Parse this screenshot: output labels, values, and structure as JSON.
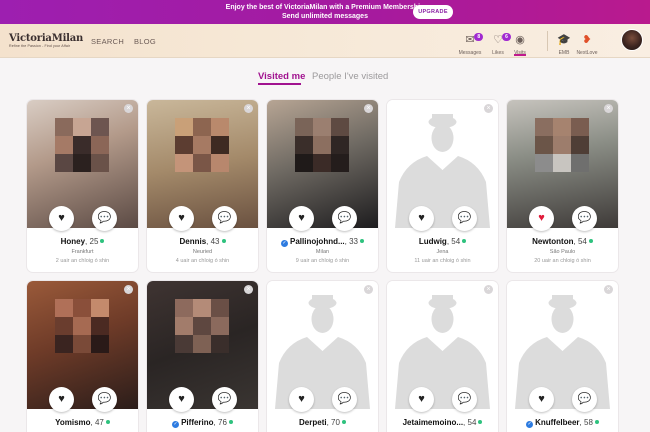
{
  "promo": {
    "line1": "Enjoy the best of VictoriaMilan with a Premium Membership",
    "line2": "Send unlimited messages",
    "button": "UPGRADE"
  },
  "nav": {
    "logo": "VictoriaMilan",
    "tagline": "Refine the Passion - Find your Affair",
    "links": [
      "SEARCH",
      "BLOG"
    ],
    "icons": [
      {
        "name": "messages-icon",
        "label": "Messages",
        "badge": "8"
      },
      {
        "name": "likes-icon",
        "label": "Likes",
        "badge": "6"
      },
      {
        "name": "visits-icon",
        "label": "Visits",
        "badge": ""
      },
      {
        "name": "emb-icon",
        "label": "EMB",
        "badge": ""
      },
      {
        "name": "nextlove-icon",
        "label": "NextLove",
        "badge": ""
      }
    ]
  },
  "tabs": {
    "active": "Visited me",
    "inactive": "People I've visited"
  },
  "accent_color": "#a1128f",
  "profiles": [
    {
      "name": "Honey",
      "age": "25",
      "city": "Frankfurt",
      "ago": "2 uair an chloig ó shin",
      "verified": false,
      "online": true,
      "liked": false
    },
    {
      "name": "Dennis",
      "age": "43",
      "city": "Neuried",
      "ago": "4 uair an chloig ó shin",
      "verified": false,
      "online": true,
      "liked": false
    },
    {
      "name": "Pallinojohnd...",
      "age": "33",
      "city": "Milan",
      "ago": "9 uair an chloig ó shin",
      "verified": true,
      "online": true,
      "liked": false
    },
    {
      "name": "Ludwig",
      "age": "54",
      "city": "Jena",
      "ago": "11 uair an chloig ó shin",
      "verified": false,
      "online": true,
      "liked": false
    },
    {
      "name": "Newtonton",
      "age": "54",
      "city": "São Paulo",
      "ago": "20 uair an chloig ó shin",
      "verified": false,
      "online": true,
      "liked": true
    },
    {
      "name": "Yomismo",
      "age": "47",
      "city": "",
      "ago": "",
      "verified": false,
      "online": true,
      "liked": false
    },
    {
      "name": "Pifferino",
      "age": "76",
      "city": "",
      "ago": "",
      "verified": true,
      "online": true,
      "liked": false
    },
    {
      "name": "Derpeti",
      "age": "70",
      "city": "",
      "ago": "",
      "verified": false,
      "online": true,
      "liked": false
    },
    {
      "name": "Jetaimemoino...",
      "age": "54",
      "city": "",
      "ago": "",
      "verified": false,
      "online": true,
      "liked": false
    },
    {
      "name": "Knuffelbeer",
      "age": "58",
      "city": "",
      "ago": "",
      "verified": true,
      "online": true,
      "liked": false
    }
  ]
}
